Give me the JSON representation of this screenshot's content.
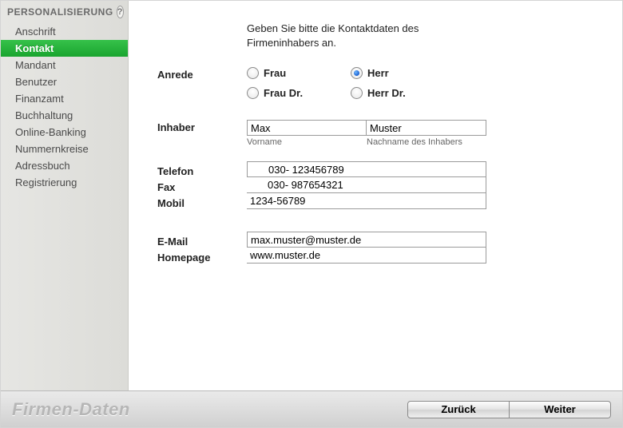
{
  "sidebar": {
    "title": "PERSONALISIERUNG",
    "help": "?",
    "items": [
      {
        "label": "Anschrift"
      },
      {
        "label": "Kontakt",
        "active": true
      },
      {
        "label": "Mandant"
      },
      {
        "label": "Benutzer"
      },
      {
        "label": "Finanzamt"
      },
      {
        "label": "Buchhaltung"
      },
      {
        "label": "Online-Banking"
      },
      {
        "label": "Nummernkreise"
      },
      {
        "label": "Adressbuch"
      },
      {
        "label": "Registrierung"
      }
    ]
  },
  "content": {
    "intro": "Geben Sie bitte die Kontaktdaten des Firmeninhabers an.",
    "labels": {
      "anrede": "Anrede",
      "inhaber": "Inhaber",
      "telefon": "Telefon",
      "fax": "Fax",
      "mobil": "Mobil",
      "email": "E-Mail",
      "homepage": "Homepage",
      "vorname_hint": "Vorname",
      "nachname_hint": "Nachname des Inhabers"
    },
    "anrede": {
      "options": {
        "frau": "Frau",
        "herr": "Herr",
        "frau_dr": "Frau Dr.",
        "herr_dr": "Herr Dr."
      },
      "selected": "herr"
    },
    "values": {
      "vorname": "Max",
      "nachname": "Muster",
      "telefon": "030- 123456789",
      "fax": "030- 987654321",
      "mobil": "1234-56789",
      "email": "max.muster@muster.de",
      "homepage": "www.muster.de"
    }
  },
  "footer": {
    "title": "Firmen-Daten",
    "back": "Zurück",
    "next": "Weiter"
  }
}
